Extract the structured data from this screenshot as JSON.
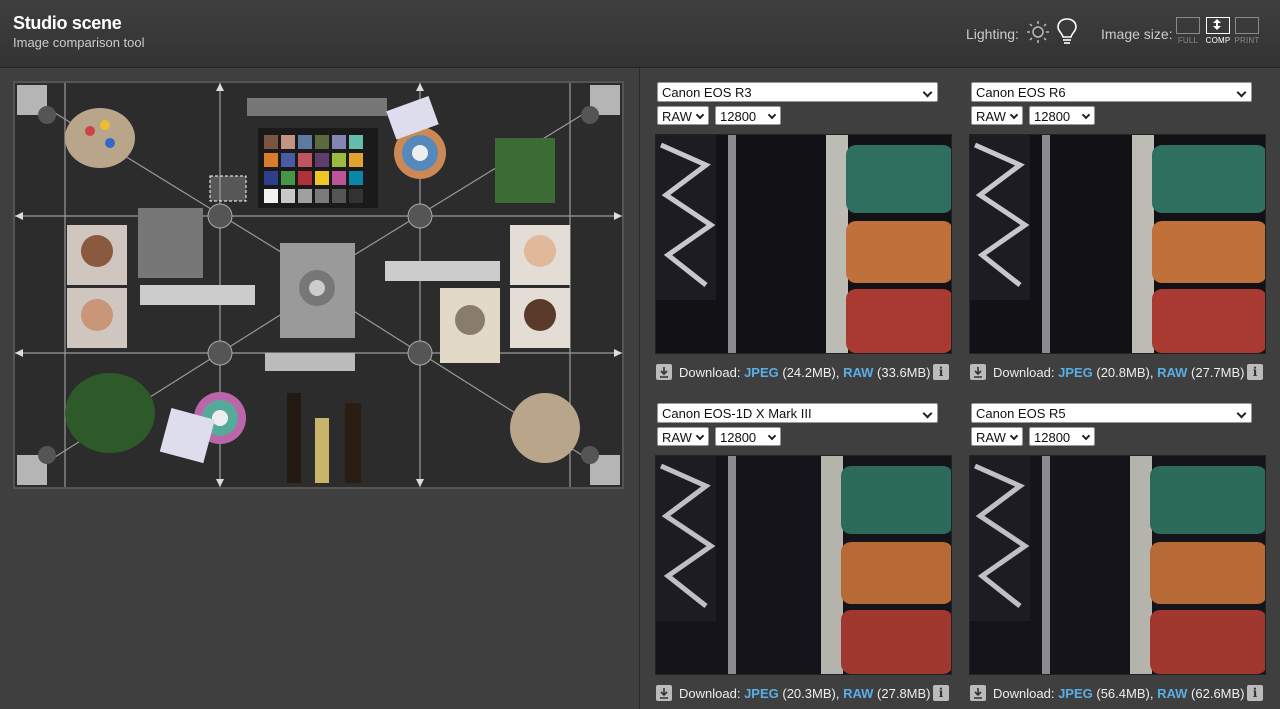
{
  "header": {
    "title": "Studio scene",
    "subtitle": "Image comparison tool",
    "lighting_label": "Lighting:",
    "image_size_label": "Image size:",
    "size_options": [
      {
        "label": "FULL",
        "active": false
      },
      {
        "label": "COMP",
        "active": true
      },
      {
        "label": "PRINT",
        "active": false
      }
    ],
    "icons": [
      "sun-icon",
      "bulb-icon"
    ]
  },
  "panels": [
    {
      "camera": "Canon EOS R3",
      "format": "RAW",
      "iso": "12800",
      "download_label": "Download:",
      "jpeg_label": "JPEG",
      "jpeg_size": "(24.2MB),",
      "raw_label": "RAW",
      "raw_size": "(33.6MB)"
    },
    {
      "camera": "Canon EOS R6",
      "format": "RAW",
      "iso": "12800",
      "download_label": "Download:",
      "jpeg_label": "JPEG",
      "jpeg_size": "(20.8MB),",
      "raw_label": "RAW",
      "raw_size": "(27.7MB)"
    },
    {
      "camera": "Canon EOS-1D X Mark III",
      "format": "RAW",
      "iso": "12800",
      "download_label": "Download:",
      "jpeg_label": "JPEG",
      "jpeg_size": "(20.3MB),",
      "raw_label": "RAW",
      "raw_size": "(27.8MB)"
    },
    {
      "camera": "Canon EOS R5",
      "format": "RAW",
      "iso": "12800",
      "download_label": "Download:",
      "jpeg_label": "JPEG",
      "jpeg_size": "(56.4MB),",
      "raw_label": "RAW",
      "raw_size": "(62.6MB)"
    }
  ],
  "colors": {
    "link": "#5aaee6",
    "background": "#3f3f3f",
    "thread_green": "#2f6f5f",
    "thread_orange": "#c0713a",
    "thread_red": "#a83a32"
  }
}
